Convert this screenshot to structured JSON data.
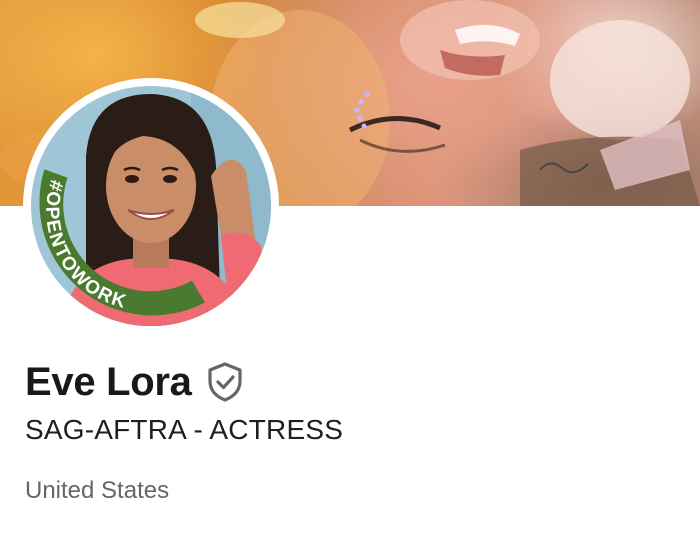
{
  "profile": {
    "name": "Eve Lora",
    "headline": "SAG-AFTRA - ACTRESS",
    "location": "United States",
    "badge_text": "#OPENTOWORK",
    "verified_icon": "shield-check-icon"
  },
  "colors": {
    "open_to_work_green": "#4a7a30",
    "name_text": "#191919",
    "secondary_text": "#666666",
    "verified_icon": "#666666"
  }
}
